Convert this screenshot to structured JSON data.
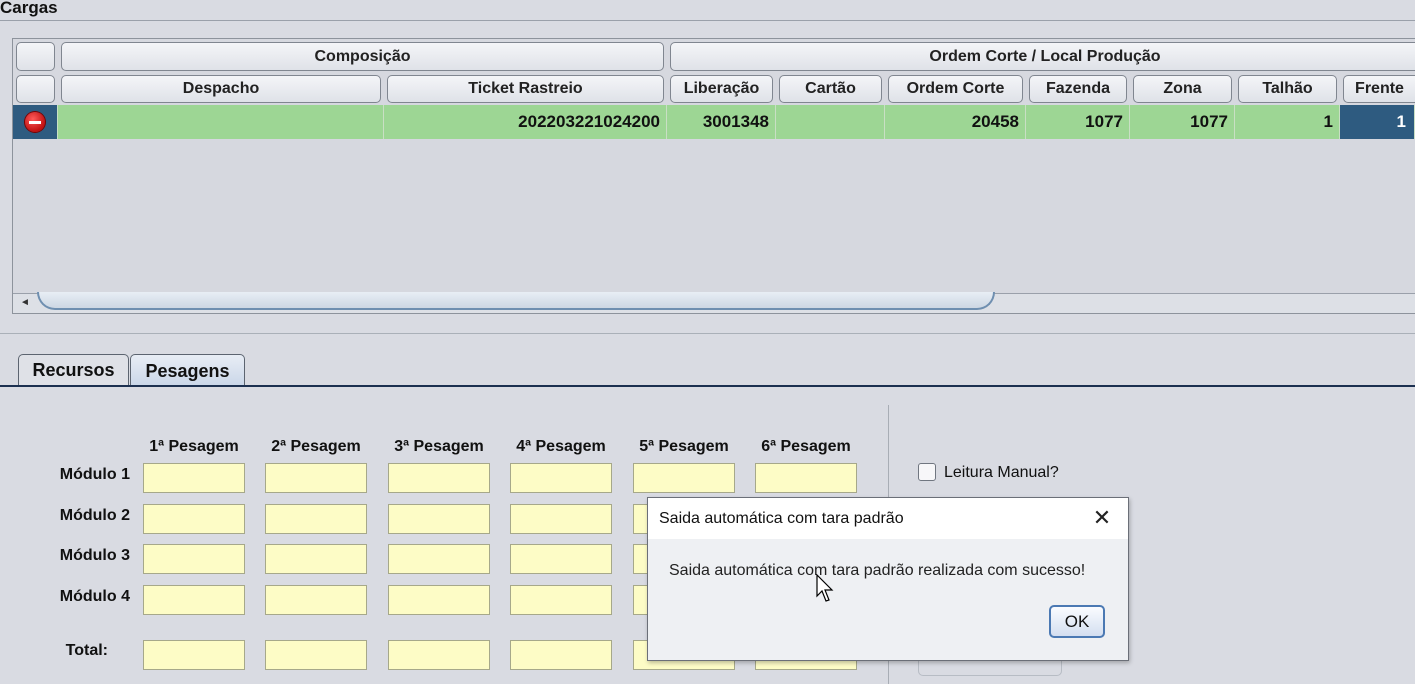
{
  "panel": {
    "title": "Cargas"
  },
  "grid": {
    "group_headers": [
      "",
      "Composição",
      "Ordem Corte / Local Produção"
    ],
    "columns": [
      "",
      "Despacho",
      "Ticket Rastreio",
      "Liberação",
      "Cartão",
      "Ordem Corte",
      "Fazenda",
      "Zona",
      "Talhão",
      "Frente"
    ],
    "row": {
      "despacho": "",
      "ticket_rastreio": "202203221024200",
      "liberacao": "3001348",
      "cartao": "",
      "ordem_corte": "20458",
      "fazenda": "1077",
      "zona": "1077",
      "talhao": "1",
      "frente": "1"
    },
    "row_icon": "minus-circle-icon",
    "scroll_left_glyph": "◄"
  },
  "tabs": [
    {
      "label": "Recursos",
      "selected": false
    },
    {
      "label": "Pesagens",
      "selected": true
    }
  ],
  "pesagens": {
    "columns": [
      "1ª Pesagem",
      "2ª Pesagem",
      "3ª Pesagem",
      "4ª Pesagem",
      "5ª Pesagem",
      "6ª Pesagem"
    ],
    "rows": [
      "Módulo 1",
      "Módulo 2",
      "Módulo 3",
      "Módulo 4"
    ],
    "total_label": "Total:",
    "manual_reading_label": "Leitura Manual?",
    "manual_reading_checked": false
  },
  "dialog": {
    "title": "Saida automática com tara padrão",
    "message": "Saida automática com tara padrão realizada com sucesso!",
    "ok_label": "OK",
    "close_glyph": "✕"
  },
  "colors": {
    "row_fill": "#9dd694",
    "selected_cell": "#2e5b80",
    "input_fill": "#fdfcc6",
    "background": "#d9dbe2"
  }
}
